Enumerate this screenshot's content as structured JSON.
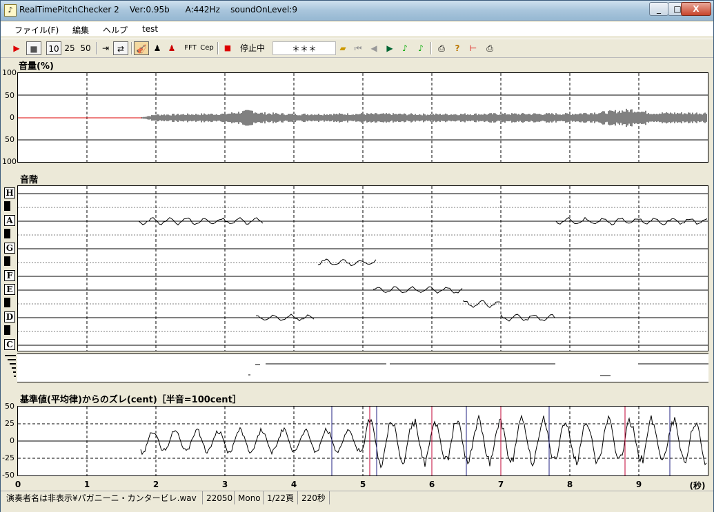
{
  "window": {
    "title": "RealTimePitchChecker 2    Ver:0.95b      A:442Hz    soundOnLevel:9",
    "minimize": "_",
    "maximize": "□",
    "close": "X"
  },
  "menu": [
    "ファイル(F)",
    "編集",
    "ヘルプ",
    "test"
  ],
  "toolbar": {
    "play": "▶",
    "stop": "■",
    "speed": [
      "10",
      "25",
      "50"
    ],
    "fft": "FFT",
    "cep": "Cep",
    "rec": "■",
    "status": "停止中",
    "stars": "＊＊＊"
  },
  "volume_panel": {
    "title": "音量(%)",
    "y_labels": [
      "100",
      "50",
      "0",
      "50",
      "100"
    ]
  },
  "scale_panel": {
    "title": "音階",
    "notes": [
      "H",
      "A",
      "G",
      "F",
      "E",
      "D",
      "C"
    ]
  },
  "cent_panel": {
    "title": "基準値(平均律)からのズレ(cent)［半音=100cent］",
    "y_labels": [
      "50",
      "25",
      "0",
      "-25",
      "-50"
    ]
  },
  "x_axis": {
    "ticks": [
      "0",
      "1",
      "2",
      "3",
      "4",
      "5",
      "6",
      "7",
      "8",
      "9"
    ],
    "unit": "(秒)"
  },
  "status": {
    "file": "演奏者名は非表示¥パガニーニ・カンタービレ.wav",
    "rate": "22050",
    "channel": "Mono",
    "page": "1/22頁",
    "length": "220秒"
  },
  "chart_data": [
    {
      "type": "line",
      "name": "volume",
      "title": "音量(%)",
      "ylim": [
        -100,
        100
      ],
      "xlim": [
        0,
        10
      ],
      "x_unit": "秒",
      "series": [
        {
          "values_desc": "waveform envelope amplitude",
          "x": [
            0,
            1.75,
            2.0,
            3.0,
            3.4,
            3.5,
            4.0,
            5.0,
            6.0,
            7.0,
            8.0,
            8.5,
            8.9,
            9.2,
            10.0
          ],
          "y": [
            0,
            0,
            8,
            10,
            18,
            12,
            9,
            10,
            9,
            10,
            10,
            14,
            20,
            12,
            12
          ]
        }
      ]
    },
    {
      "type": "line",
      "name": "pitch",
      "title": "音階",
      "x_unit": "秒",
      "segments": [
        {
          "note": "A",
          "x": [
            1.75,
            3.57
          ]
        },
        {
          "note": "D",
          "x": [
            3.45,
            4.3
          ]
        },
        {
          "note": "G",
          "x": [
            4.35,
            5.2
          ]
        },
        {
          "note": "E",
          "x": [
            5.15,
            6.45
          ]
        },
        {
          "note": "D#",
          "x": [
            6.45,
            7.0
          ]
        },
        {
          "note": "D",
          "x": [
            7.0,
            7.8
          ]
        },
        {
          "note": "A",
          "x": [
            7.8,
            10.0
          ]
        }
      ]
    },
    {
      "type": "line",
      "name": "cent",
      "title": "基準値(平均律)からのズレ(cent)［半音=100cent］",
      "ylim": [
        -50,
        50
      ],
      "xlim": [
        0,
        10
      ],
      "x_unit": "秒",
      "grid_y": [
        25,
        0,
        -25
      ]
    }
  ]
}
